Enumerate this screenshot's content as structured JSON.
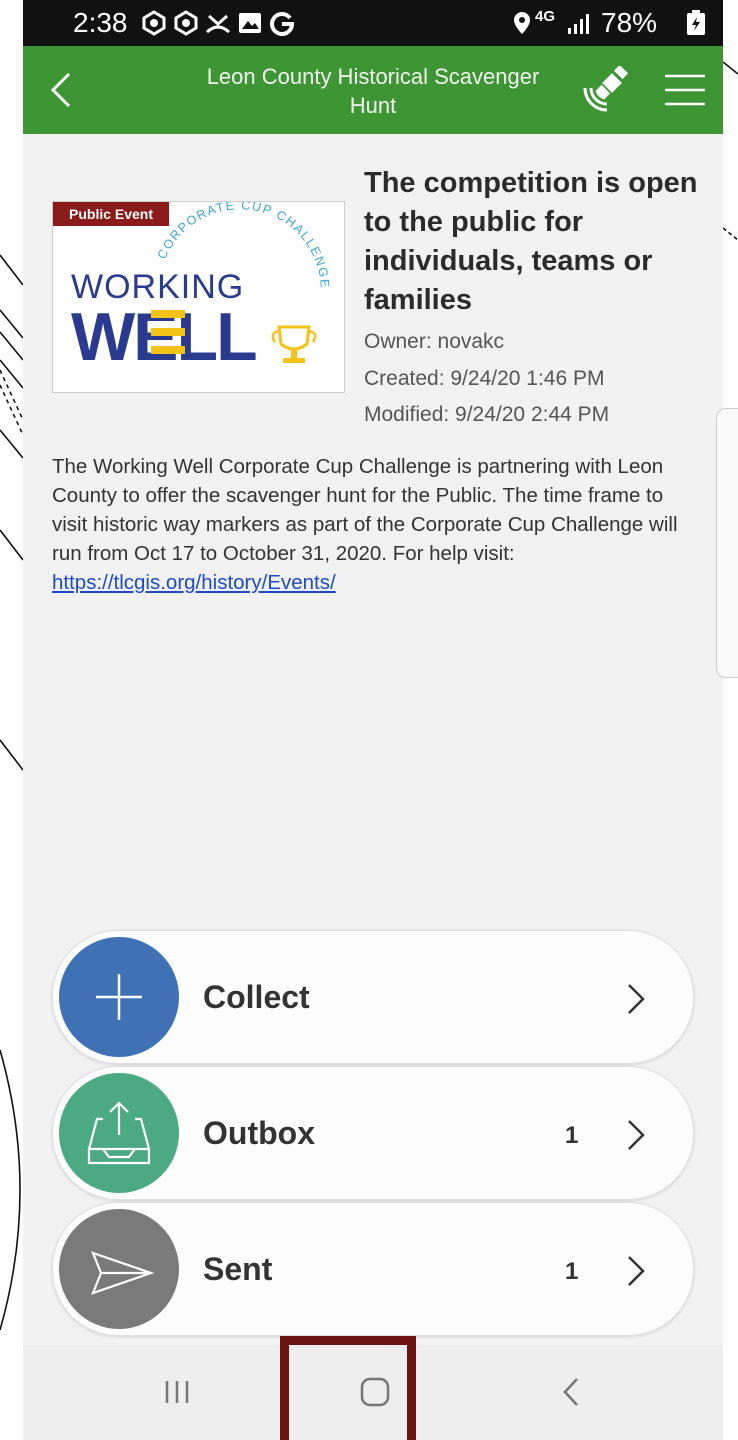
{
  "status_bar": {
    "time": "2:38",
    "network": "4G",
    "battery": "78%"
  },
  "header": {
    "title": "Leon County Historical Scavenger Hunt",
    "color": "#3d9534"
  },
  "event": {
    "badge": "Public Event",
    "logo": {
      "line1": "CORPORATE CUP CHALLENGE",
      "line2": "WORKING",
      "line3": "WELL"
    },
    "title": "The competition is open to the public for individuals, teams or families",
    "owner": "Owner: novakc",
    "created": "Created: 9/24/20 1:46 PM",
    "modified": "Modified: 9/24/20 2:44 PM",
    "description": "The Working Well Corporate Cup Challenge is partnering with Leon County to offer the scavenger hunt for the Public. The time frame to visit historic way markers as part of the Corporate Cup Challenge will run from Oct 17 to October 31, 2020. For help visit:",
    "link": "https://tlcgis.org/history/Events/"
  },
  "actions": {
    "collect": {
      "label": "Collect",
      "icon": "plus-icon",
      "color": "#3e72b5"
    },
    "outbox": {
      "label": "Outbox",
      "count": "1",
      "icon": "outbox-tray-icon",
      "color": "#4caa82"
    },
    "sent": {
      "label": "Sent",
      "count": "1",
      "icon": "paper-plane-icon",
      "color": "#7a7a7a"
    }
  },
  "nav": {
    "recents": "recents-icon",
    "home": "home-icon",
    "back": "back-icon",
    "highlight_color": "#6b1212"
  }
}
